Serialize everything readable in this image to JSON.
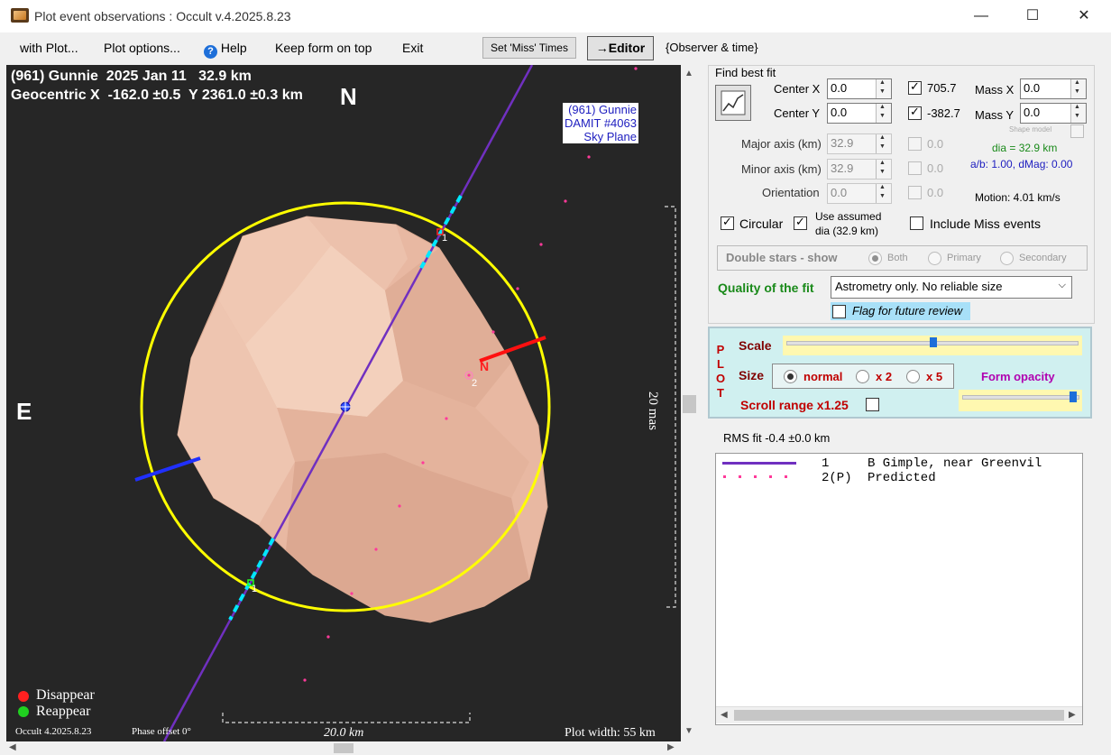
{
  "window": {
    "title": "Plot event observations : Occult v.4.2025.8.23",
    "minimize": "—",
    "maximize": "☐",
    "close": "✕"
  },
  "menu": {
    "with_plot": "with Plot...",
    "plot_options": "Plot options...",
    "help": "Help",
    "keep_on_top": "Keep form on top",
    "exit": "Exit",
    "set_miss_times": "Set 'Miss' Times",
    "editor": "→Editor",
    "observer_time": "{Observer & time}"
  },
  "plot": {
    "header_line1": "(961) Gunnie  2025 Jan 11   32.9 km",
    "header_line2": "Geocentric X  -162.0 ±0.5  Y 2361.0 ±0.3 km",
    "north": "N",
    "east": "E",
    "model_label": [
      "(961) Gunnie",
      "DAMIT #4063",
      "Sky Plane"
    ],
    "scale_vertical": "20 mas",
    "scale_horizontal": "20.0 km",
    "legend_disappear": "Disappear",
    "legend_reappear": "Reappear",
    "version": "Occult 4.2025.8.23",
    "phase_offset": "Phase offset 0°",
    "plot_width": "Plot width: 55 km",
    "chord_label_1": "1",
    "chord_label_2": "2",
    "pole_label": "N",
    "chord_bottom_label": "1"
  },
  "fit": {
    "find_best_fit": "Find best fit",
    "center_x_label": "Center X",
    "center_x": "0.0",
    "center_y_label": "Center Y",
    "center_y": "0.0",
    "x_readout": "705.7",
    "y_readout": "-382.7",
    "mass_x_label": "Mass X",
    "mass_x": "0.0",
    "mass_y_label": "Mass Y",
    "mass_y": "0.0",
    "shape_model": "Shape model",
    "major_label": "Major axis (km)",
    "major": "32.9",
    "minor_label": "Minor axis (km)",
    "minor": "32.9",
    "orient_label": "Orientation",
    "orient": "0.0",
    "zero1": "0.0",
    "zero2": "0.0",
    "zero3": "0.0",
    "dia": "dia = 32.9 km",
    "ab": "a/b: 1.00, dMag: 0.00",
    "motion": "Motion: 4.01 km/s",
    "circular": "Circular",
    "use_assumed": "Use assumed",
    "use_assumed2": "dia (32.9 km)",
    "include_miss": "Include Miss events",
    "double_stars": "Double stars - show",
    "both": "Both",
    "primary": "Primary",
    "secondary": "Secondary",
    "quality_label": "Quality of the fit",
    "quality_value": "Astrometry only. No reliable size",
    "flag_review": "Flag for future review"
  },
  "plotopts": {
    "plot_vertical": [
      "P",
      "L",
      "O",
      "T"
    ],
    "scale": "Scale",
    "size": "Size",
    "normal": "normal",
    "x2": "x 2",
    "x5": "x 5",
    "form_opacity": "Form opacity",
    "scroll_range": "Scroll range x1.25"
  },
  "rms": "RMS fit -0.4 ±0.0 km",
  "list": [
    {
      "num": "1",
      "text": "B Gimple, near Greenvil"
    },
    {
      "num": "2(P)",
      "text": "Predicted"
    }
  ],
  "colors": {
    "accent_green": "#1a8a1a",
    "brand_red": "#c00000",
    "purple": "#800080"
  }
}
